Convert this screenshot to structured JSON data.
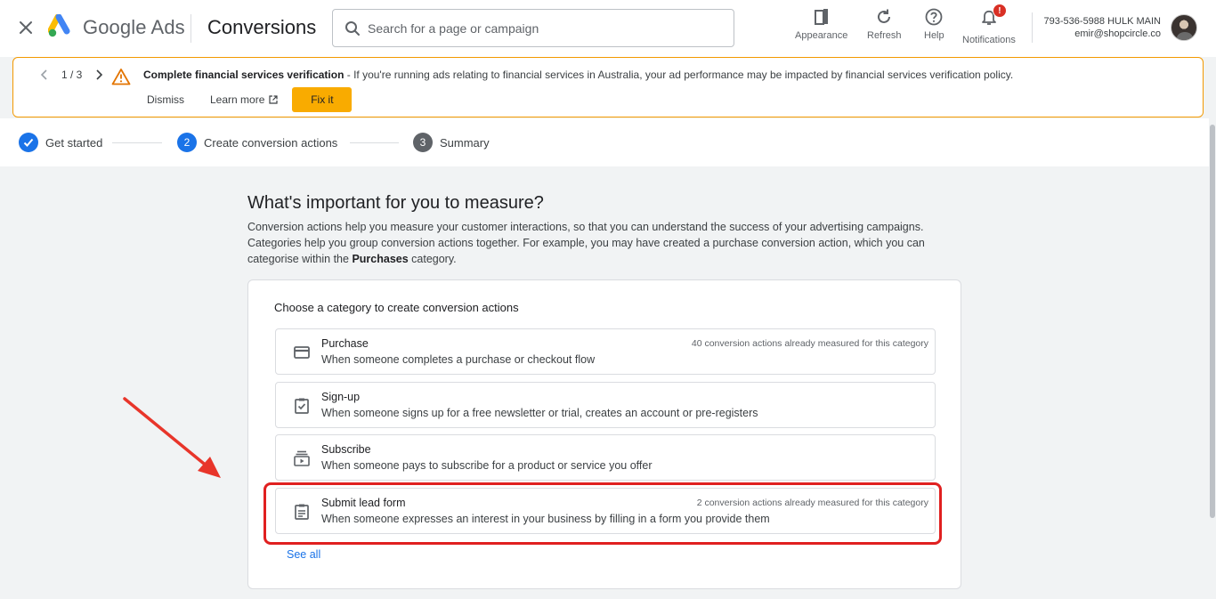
{
  "header": {
    "brand": "Google Ads",
    "page_title": "Conversions",
    "search_placeholder": "Search for a page or campaign",
    "tools": [
      {
        "label": "Appearance",
        "icon": "appearance-icon"
      },
      {
        "label": "Refresh",
        "icon": "refresh-icon"
      },
      {
        "label": "Help",
        "icon": "help-icon"
      },
      {
        "label": "Notifications",
        "icon": "bell-icon"
      }
    ],
    "notification_badge": "!",
    "account_line1": "793-536-5988 HULK MAIN",
    "account_line2": "emir@shopcircle.co"
  },
  "banner": {
    "page_indicator": "1 / 3",
    "title": "Complete financial services verification",
    "message": " - If you're running ads relating to financial services in Australia, your ad performance may be impacted by financial services verification policy.",
    "dismiss": "Dismiss",
    "learn_more": "Learn more",
    "fix_it": "Fix it",
    "accent_color": "#f29900"
  },
  "stepper": {
    "steps": [
      {
        "number": "1",
        "label": "Get started",
        "state": "done"
      },
      {
        "number": "2",
        "label": "Create conversion actions",
        "state": "active"
      },
      {
        "number": "3",
        "label": "Summary",
        "state": "pending"
      }
    ]
  },
  "main": {
    "title": "What's important for you to measure?",
    "desc_line1": "Conversion actions help you measure your customer interactions, so that you can understand the success of your advertising campaigns.",
    "desc_line2": "Categories help you group conversion actions together. For example, you may have created a purchase conversion action, which you can",
    "desc_line3_pre": "categorise within the ",
    "desc_line3_bold": "Purchases",
    "desc_line3_post": " category.",
    "card_heading": "Choose a category to create conversion actions",
    "options": [
      {
        "title": "Purchase",
        "description": "When someone completes a purchase or checkout flow",
        "meta": "40 conversion actions already measured for this category",
        "icon": "credit-card-icon"
      },
      {
        "title": "Sign-up",
        "description": "When someone signs up for a free newsletter or trial, creates an account or pre-registers",
        "meta": "",
        "icon": "clipboard-check-icon"
      },
      {
        "title": "Subscribe",
        "description": "When someone pays to subscribe for a product or service you offer",
        "meta": "",
        "icon": "subscriptions-icon"
      },
      {
        "title": "Submit lead form",
        "description": "When someone expresses an interest in your business by filling in a form you provide them",
        "meta": "2 conversion actions already measured for this category",
        "icon": "form-icon"
      }
    ],
    "see_all": "See all"
  },
  "annotation": {
    "highlight_color": "#e02020"
  }
}
